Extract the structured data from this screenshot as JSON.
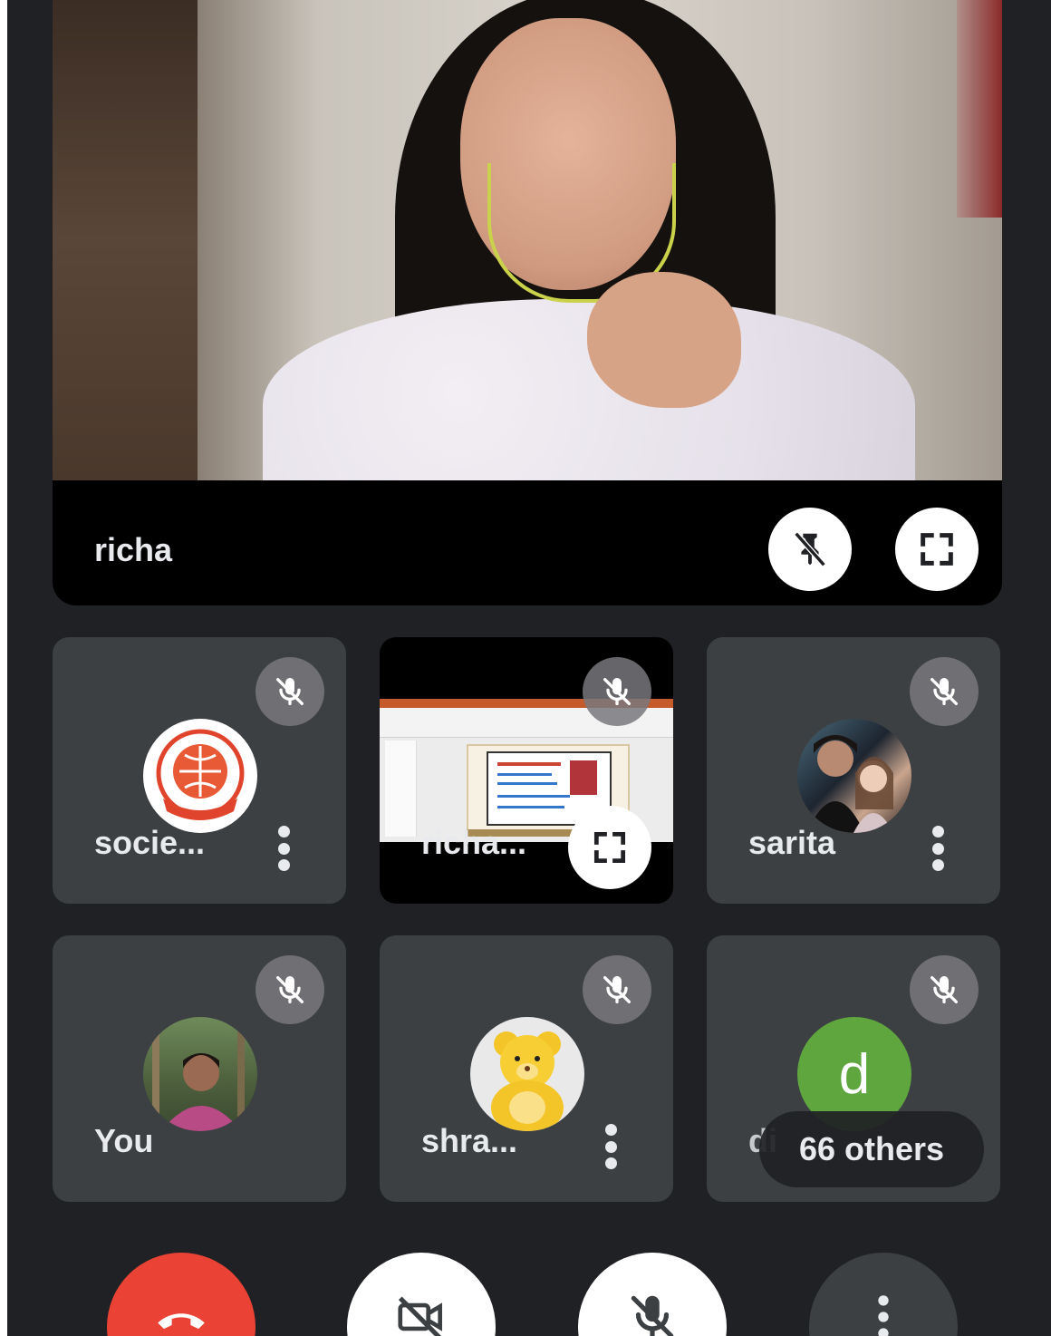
{
  "main_tile": {
    "participant_name": "richa",
    "unpin_icon": "pin-off-icon",
    "fullscreen_icon": "fullscreen-icon"
  },
  "tiles": [
    {
      "name": "socie...",
      "muted": true,
      "avatar": "society-logo"
    },
    {
      "name": "richa...",
      "muted": true,
      "avatar": "presentation"
    },
    {
      "name": "sarita",
      "muted": true,
      "avatar": "photo"
    },
    {
      "name": "You",
      "muted": true,
      "avatar": "photo"
    },
    {
      "name": "shra...",
      "muted": true,
      "avatar": "teddy-bear"
    },
    {
      "name": "di",
      "muted": true,
      "avatar_letter": "d",
      "avatar_color": "#5fa63f"
    }
  ],
  "others_label": "66 others",
  "controls": {
    "end_call_icon": "phone-hangup-icon",
    "camera_icon": "camera-off-icon",
    "mic_icon": "mic-off-icon",
    "more_icon": "more-vert-icon",
    "end_call_color": "#ea4335"
  }
}
